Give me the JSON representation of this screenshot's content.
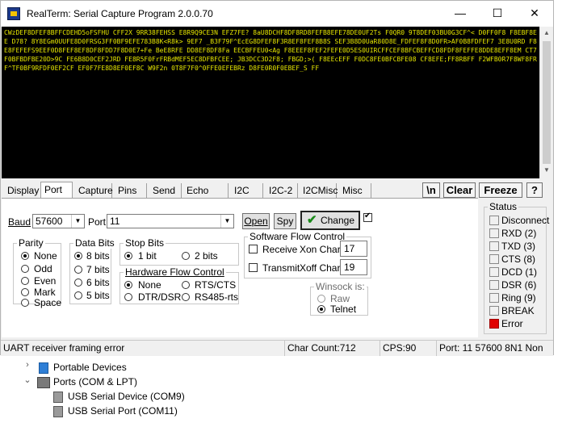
{
  "window": {
    "title": "RealTerm: Serial Capture Program 2.0.0.70",
    "minimize": "—",
    "maximize": "☐",
    "close": "✕"
  },
  "terminal": {
    "text": "CWzDEF8DFEF8BFFCDEHD5oFSFHU CFF2X 9RR38FEHSS E8R9Q9CE3N EFZ7FE? 8aU8DCHF8DF8RD8FEFB8EFE78DE0UF2Ts F0QR0 9T8DEF03BU0G3CF^< D0FF0F8 F8EBF8EE D78? 8Y8EGm0UUFE8D0FRSG3FF0BF9EFE783B8K<R8k> 9EF7 _B3F79F^EcEG8DFEF8F3R8EF8FEF8B8S SEF3B8D0UaR80D8E_FDFEF8F8D0FR>AF0B8FDFEF7 3E8U0RD F8E8FEFEFS9EEF0D8FEF8EF8DF8FDD7F8D0E7+Fe BeE8RFE DD8EF8DF8Fa EECBFFEU0<Ag F8EEEF8FEF2FEFE0D5ES0UIRCFFCEF8BFCBEFFCD8FDF8FEFFE8DDE8EFF8EM CT7F0BFBDFBE20D>9C FE6B8D0CEF2JRD FE8R5F0FrFRBdMEF5EC8DFBFCEE; JB3DCC3D2F8; FBGD;>( F8EEcEFF F0DC8FE0BFCBFE08 CF8EFE;FF8RBFF F2WFB0R7F8WF8FRF^TF0BF9RFDF0EF2CF EF0F7FE8D8EF0EF8C W9F2n 0T8F7F0^0FFE0EFEBRz D8FE0R0F0EBEF_S FF"
  },
  "tabs": {
    "display": "Display",
    "port": "Port",
    "capture": "Capture",
    "pins": "Pins",
    "send": "Send",
    "echo_port": "Echo Port",
    "i2c": "I2C",
    "i2c2": "I2C-2",
    "i2cmisc": "I2CMisc",
    "misc": "Misc"
  },
  "toolbar": {
    "newline": "\\n",
    "clear": "Clear",
    "freeze": "Freeze",
    "help": "?"
  },
  "port": {
    "baud_label": "Baud",
    "baud_value": "57600",
    "port_label": "Port",
    "port_value": "11",
    "open_label": "Open",
    "spy_label": "Spy",
    "change_label": "Change",
    "parity": {
      "title": "Parity",
      "options": [
        "None",
        "Odd",
        "Even",
        "Mark",
        "Space"
      ],
      "selected": "None"
    },
    "data_bits": {
      "title": "Data Bits",
      "options": [
        "8 bits",
        "7 bits",
        "6 bits",
        "5 bits"
      ],
      "selected": "8 bits"
    },
    "stop_bits": {
      "title": "Stop Bits",
      "options": [
        "1 bit",
        "2 bits"
      ],
      "selected": "1 bit"
    },
    "hw_flow": {
      "title": "Hardware Flow Control",
      "options": [
        "None",
        "RTS/CTS",
        "DTR/DSR",
        "RS485-rts"
      ],
      "selected": "None"
    },
    "sw_flow": {
      "title": "Software Flow Control",
      "receive_label": "Receive",
      "xon_label": "Xon Char:",
      "xon_value": "17",
      "transmit_label": "Transmit",
      "xoff_label": "Xoff Char:",
      "xoff_value": "19"
    },
    "winsock": {
      "title": "Winsock is:",
      "options": [
        "Raw",
        "Telnet"
      ],
      "selected": "Telnet"
    }
  },
  "status": {
    "title": "Status",
    "items": [
      "Disconnect",
      "RXD (2)",
      "TXD (3)",
      "CTS (8)",
      "DCD (1)",
      "DSR (6)",
      "Ring (9)",
      "BREAK",
      "Error"
    ],
    "error_color": "#e00000"
  },
  "statusbar": {
    "message": "UART receiver framing error",
    "char_count": "Char Count:712",
    "cps": "CPS:90",
    "port_info": "Port: 11 57600 8N1 Non"
  },
  "device_manager": {
    "items": [
      {
        "label": "Portable Devices",
        "chevron": "›"
      },
      {
        "label": "Ports (COM & LPT)",
        "chevron": "⌄"
      },
      {
        "label": "USB Serial Device (COM9)"
      },
      {
        "label": "USB Serial Port (COM11)"
      }
    ]
  }
}
